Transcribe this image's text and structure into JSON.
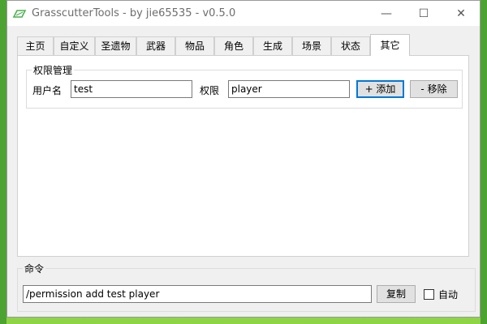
{
  "window": {
    "title": "GrasscutterTools  - by jie65535  - v0.5.0",
    "minimize_glyph": "—",
    "maximize_glyph": "☐",
    "close_glyph": "✕"
  },
  "tabs": [
    {
      "label": "主页"
    },
    {
      "label": "自定义"
    },
    {
      "label": "圣遗物"
    },
    {
      "label": "武器"
    },
    {
      "label": "物品"
    },
    {
      "label": "角色"
    },
    {
      "label": "生成"
    },
    {
      "label": "场景"
    },
    {
      "label": "状态"
    },
    {
      "label": "其它"
    }
  ],
  "active_tab": "其它",
  "permission": {
    "group_title": "权限管理",
    "username_label": "用户名",
    "username_value": "test",
    "permission_label": "权限",
    "permission_value": "player",
    "add_button": "+ 添加",
    "remove_button": "- 移除"
  },
  "command": {
    "group_title": "命令",
    "value": "/permission add test player",
    "copy_button": "复制",
    "auto_label": "自动",
    "auto_checked": false
  }
}
